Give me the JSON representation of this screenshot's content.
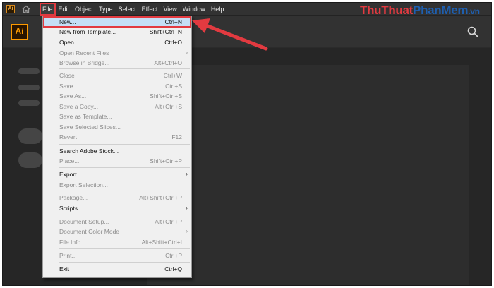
{
  "menubar": {
    "items": [
      {
        "label": "File",
        "active": true
      },
      {
        "label": "Edit"
      },
      {
        "label": "Object"
      },
      {
        "label": "Type"
      },
      {
        "label": "Select"
      },
      {
        "label": "Effect"
      },
      {
        "label": "View"
      },
      {
        "label": "Window"
      },
      {
        "label": "Help"
      }
    ]
  },
  "app": {
    "small_icon_text": "Ai",
    "logo_text": "Ai"
  },
  "watermark": {
    "part1": "ThuThuat",
    "part2": "PhanMem",
    "part3": ".vn",
    "color1": "#e23a40",
    "color2": "#1e5fb0"
  },
  "file_menu": [
    {
      "label": "New...",
      "shortcut": "Ctrl+N",
      "disabled": false,
      "highlight": true
    },
    {
      "label": "New from Template...",
      "shortcut": "Shift+Ctrl+N"
    },
    {
      "label": "Open...",
      "shortcut": "Ctrl+O"
    },
    {
      "label": "Open Recent Files",
      "shortcut": "",
      "disabled": true,
      "submenu": true
    },
    {
      "label": "Browse in Bridge...",
      "shortcut": "Alt+Ctrl+O",
      "disabled": true
    },
    {
      "label": "Close",
      "shortcut": "Ctrl+W",
      "disabled": true
    },
    {
      "label": "Save",
      "shortcut": "Ctrl+S",
      "disabled": true
    },
    {
      "label": "Save As...",
      "shortcut": "Shift+Ctrl+S",
      "disabled": true
    },
    {
      "label": "Save a Copy...",
      "shortcut": "Alt+Ctrl+S",
      "disabled": true
    },
    {
      "label": "Save as Template...",
      "shortcut": "",
      "disabled": true
    },
    {
      "label": "Save Selected Slices...",
      "shortcut": "",
      "disabled": true
    },
    {
      "label": "Revert",
      "shortcut": "F12",
      "disabled": true
    },
    {
      "label": "Search Adobe Stock...",
      "shortcut": ""
    },
    {
      "label": "Place...",
      "shortcut": "Shift+Ctrl+P",
      "disabled": true
    },
    {
      "label": "Export",
      "shortcut": "",
      "submenu": true
    },
    {
      "label": "Export Selection...",
      "shortcut": "",
      "disabled": true
    },
    {
      "label": "Package...",
      "shortcut": "Alt+Shift+Ctrl+P",
      "disabled": true
    },
    {
      "label": "Scripts",
      "shortcut": "",
      "submenu": true
    },
    {
      "label": "Document Setup...",
      "shortcut": "Alt+Ctrl+P",
      "disabled": true
    },
    {
      "label": "Document Color Mode",
      "shortcut": "",
      "disabled": true,
      "submenu": true
    },
    {
      "label": "File Info...",
      "shortcut": "Alt+Shift+Ctrl+I",
      "disabled": true
    },
    {
      "label": "Print...",
      "shortcut": "Ctrl+P",
      "disabled": true
    },
    {
      "label": "Exit",
      "shortcut": "Ctrl+Q"
    }
  ],
  "colors": {
    "annotation": "#e23a40",
    "highlight": "#c5dff6"
  }
}
